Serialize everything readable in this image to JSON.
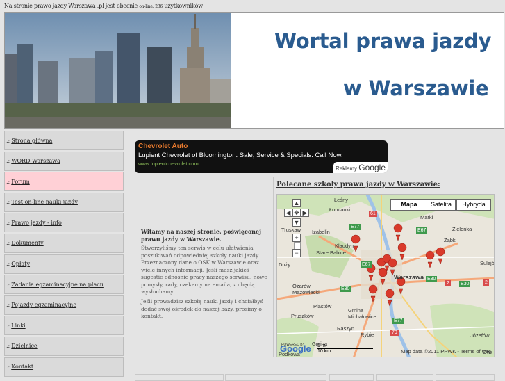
{
  "top_line": {
    "prefix": "Na stronie prawo jazdy Warszawa .pl jest obecnie",
    "small": "on-line: 236",
    "suffix": "użytkowników"
  },
  "banner": {
    "title_line1": "Wortal prawa jazdy",
    "title_line2": "w Warszawie"
  },
  "nav": [
    {
      "label": "Strona główna"
    },
    {
      "label": "WORD Warszawa"
    },
    {
      "label": "Forum"
    },
    {
      "label": "Test on-line nauki jazdy"
    },
    {
      "label": "Prawo jazdy - info"
    },
    {
      "label": "Dokumenty"
    },
    {
      "label": "Opłaty"
    },
    {
      "label": "Zadania egzaminacyjne na placu"
    },
    {
      "label": "Pojazdy egzaminacyjne"
    },
    {
      "label": "Linki"
    },
    {
      "label": "Dzielnice"
    },
    {
      "label": "Kontakt"
    }
  ],
  "nav_prefix": ".:",
  "ad": {
    "title": "Chevrolet Auto",
    "description": "Lupient Chevrolet of Bloomington. Sale, Service & Specials. Call Now.",
    "url": "www.lupientchevrolet.com",
    "badge_text": "Reklamy",
    "badge_brand": "Google"
  },
  "welcome": {
    "title": "Witamy na naszej stronie, poświęconej prawu jazdy w Warszawie.",
    "p1": "Stworzyliśmy ten serwis w celu ułatwienia poszukiwań odpowiedniej szkoły nauki jazdy. Przeznaczony dane o OSK w Warszawie oraz wiele innych informacji. Jeśli masz jakieś sugestie odnośnie pracy naszego serwisu, nowe pomysły, rady, czekamy na emaila, z chęcią wysłuchamy.",
    "p2": "Jeśli prowadzisz szkołę nauki jazdy i chciałbyś dodać swój ośrodek do naszej bazy, prosimy o kontakt."
  },
  "map_section": {
    "heading": "Polecane szkoły prawa jazdy w Warszawie:",
    "map_types": [
      "Mapa",
      "Satelita",
      "Hybryda"
    ],
    "place_labels": [
      "Łomianki",
      "Łeśny",
      "Marki",
      "Zielonka",
      "Ząbki",
      "Truskaw",
      "Izabelin",
      "Stare Babice",
      "Klaudyn",
      "Duży",
      "Ożarów Mazowiecki",
      "Piastów",
      "Pruszków",
      "Gmina Michałowice",
      "Raszyn",
      "Rybie",
      "Warszawa",
      "Sulejó",
      "Józefów",
      "Podkowa",
      "Otw",
      "Gmina"
    ],
    "road_labels": [
      "61",
      "E77",
      "E67",
      "E67",
      "E30",
      "E30",
      "2",
      "E30",
      "2",
      "E77",
      "79"
    ],
    "scale_mi": "5 mi",
    "scale_km": "10 km",
    "powered_by": "POWERED BY",
    "google": "Google",
    "map_data": "Map data ©2011 PPWK - Terms of Use"
  }
}
